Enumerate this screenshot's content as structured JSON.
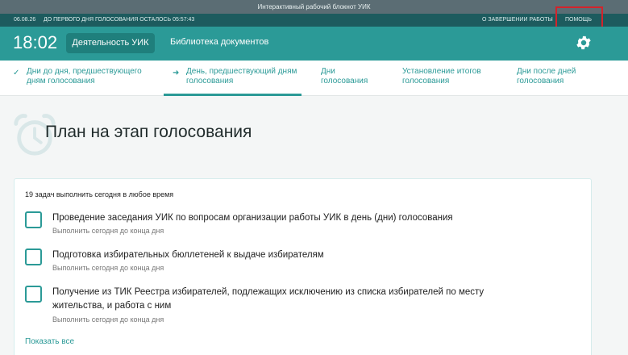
{
  "window": {
    "title": "Интерактивный рабочий блокнот УИК"
  },
  "status": {
    "date": "06.08.26",
    "countdown": "ДО ПЕРВОГО ДНЯ ГОЛОСОВАНИЯ ОСТАЛОСЬ 05:57:43",
    "finish_label": "О ЗАВЕРШЕНИИ РАБОТЫ",
    "help_label": "ПОМОЩЬ"
  },
  "header": {
    "time": "18:02",
    "activity_label": "Деятельность УИК",
    "library_label": "Библиотека документов"
  },
  "steps": [
    {
      "line1": "Дни до дня, предшествующего",
      "line2": "дням голосования",
      "state": "done"
    },
    {
      "line1": "День, предшествующий дням",
      "line2": "голосования",
      "state": "active"
    },
    {
      "line1": "Дни",
      "line2": "голосования",
      "state": "pending"
    },
    {
      "line1": "Установление итогов",
      "line2": "голосования",
      "state": "pending"
    },
    {
      "line1": "Дни после дней",
      "line2": "голосования",
      "state": "pending"
    }
  ],
  "page": {
    "title": "План на этап голосования"
  },
  "tasks": {
    "summary": "19 задач выполнить сегодня в любое время",
    "items": [
      {
        "title": "Проведение заседания УИК по вопросам организации работы УИК в день (дни) голосования",
        "subtitle": "Выполнить сегодня до конца дня"
      },
      {
        "title": "Подготовка избирательных бюллетеней к выдаче избирателям",
        "subtitle": "Выполнить сегодня до конца дня"
      },
      {
        "title": "Получение из ТИК Реестра избирателей, подлежащих исключению из списка избирателей по месту жительства, и работа с ним",
        "subtitle": "Выполнить сегодня до конца дня"
      }
    ],
    "show_all_label": "Показать все"
  },
  "colors": {
    "accent": "#2b9a97",
    "status_bar": "#1d5b5e",
    "highlight": "#d3232b"
  }
}
